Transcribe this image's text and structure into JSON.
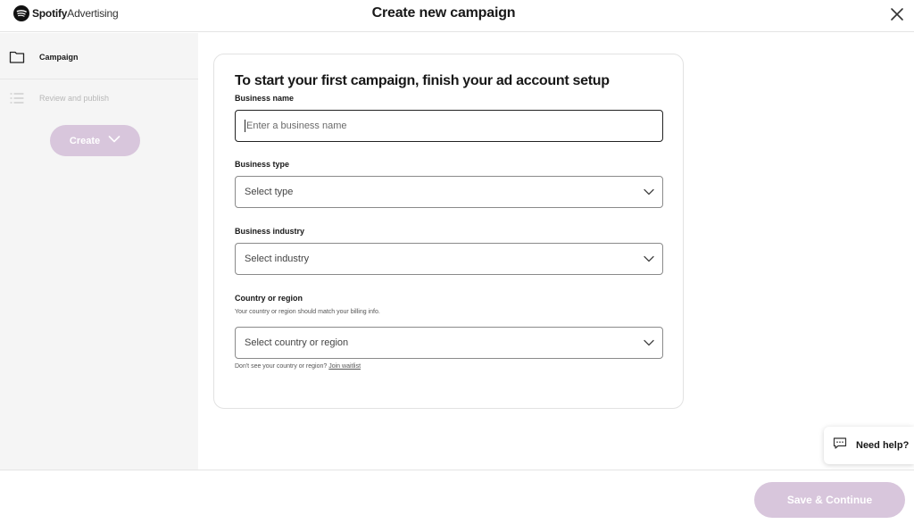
{
  "header": {
    "brand_name": "Spotify",
    "brand_product": "Advertising",
    "title": "Create new campaign",
    "icons": {
      "logo": "spotify-logo-icon",
      "close": "close-icon"
    }
  },
  "sidebar": {
    "items": [
      {
        "label": "Campaign",
        "icon": "folder-icon",
        "state": "active"
      },
      {
        "label": "Review and publish",
        "icon": "list-icon",
        "state": "disabled"
      }
    ],
    "create_label": "Create"
  },
  "form": {
    "title": "To start your first campaign, finish your ad account setup",
    "business_name": {
      "label": "Business name",
      "placeholder": "Enter a business name",
      "value": ""
    },
    "business_type": {
      "label": "Business type",
      "value": "Select type"
    },
    "business_industry": {
      "label": "Business industry",
      "value": "Select industry"
    },
    "country": {
      "label": "Country or region",
      "help": "Your country or region should match your billing info.",
      "value": "Select country or region"
    },
    "waitlist_note": "Don't see your country or region?",
    "waitlist_link": "Join waitlist"
  },
  "help": {
    "label": "Need help?",
    "icon": "chat-icon"
  },
  "footer": {
    "save_label": "Save & Continue"
  },
  "colors": {
    "accent_disabled": "#d8c6dc",
    "sidebar_bg": "#f5f5f5",
    "text": "#181818"
  }
}
